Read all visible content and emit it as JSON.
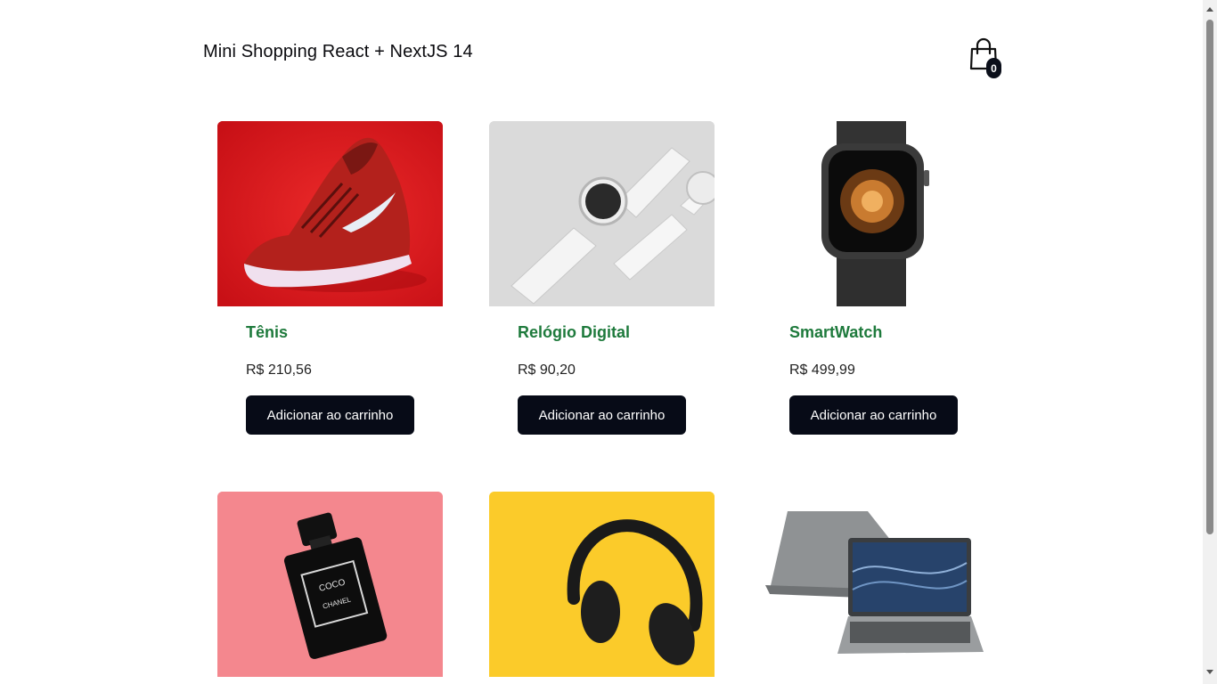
{
  "header": {
    "title": "Mini Shopping React + NextJS 14",
    "cart_count": "0",
    "cart_icon": "shopping-bag-icon"
  },
  "products": [
    {
      "title": "Tênis",
      "price": "R$ 210,56",
      "button": "Adicionar ao carrinho",
      "image": "red-sneaker-image",
      "bg": "#df1a1f"
    },
    {
      "title": "Relógio Digital",
      "price": "R$ 90,20",
      "button": "Adicionar ao carrinho",
      "image": "white-watches-image",
      "bg": "#d9d9d9"
    },
    {
      "title": "SmartWatch",
      "price": "R$ 499,99",
      "button": "Adicionar ao carrinho",
      "image": "smartwatch-image",
      "bg": "#ffffff"
    },
    {
      "image": "perfume-bottle-image",
      "bg": "#f4878e"
    },
    {
      "image": "headphones-image",
      "bg": "#fbcb2a"
    },
    {
      "image": "laptop-image",
      "bg": "#ffffff"
    }
  ],
  "colors": {
    "title_green": "#1e7a3c",
    "button_dark": "#070b17"
  }
}
